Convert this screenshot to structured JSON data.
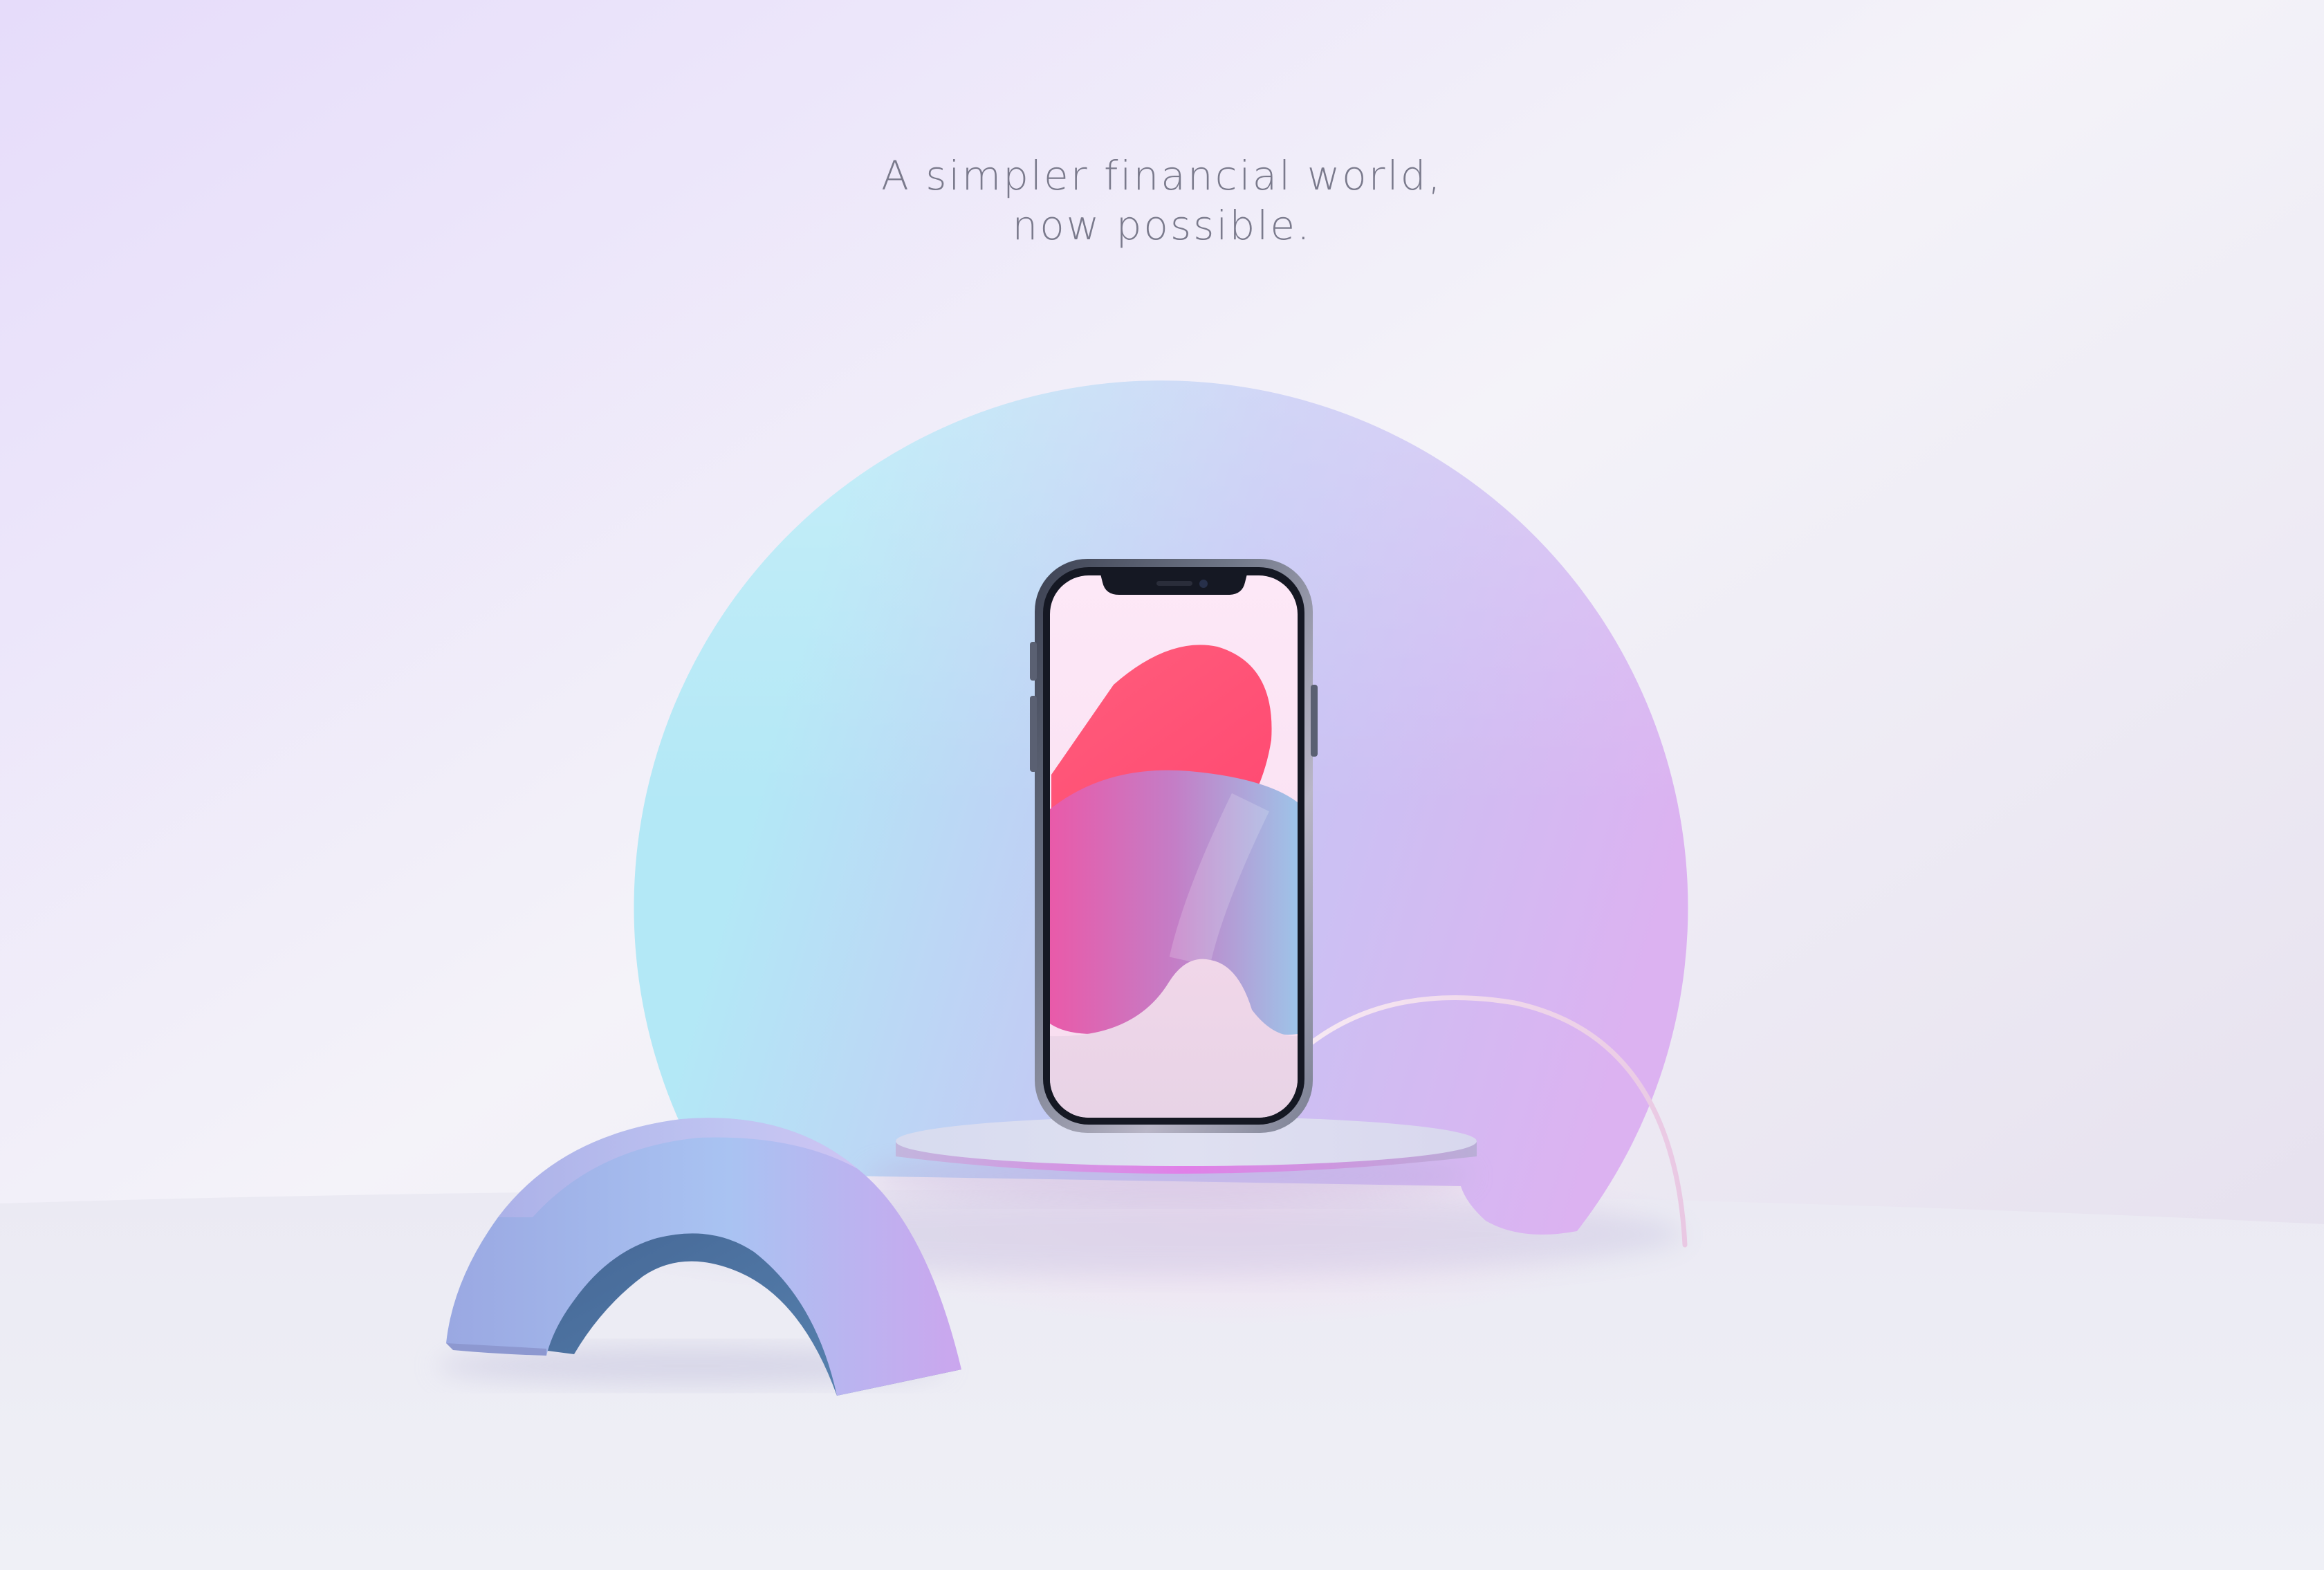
{
  "tagline": {
    "line1": "A simpler financial world,",
    "line2": "now possible."
  },
  "colors": {
    "background_top_left": "#e6dcfa",
    "background_light": "#f4f3f9",
    "background_right": "#e3ddec",
    "floor": "#eff0f6",
    "disc_cyan": "#b3e8f6",
    "disc_blue": "#c4c7f4",
    "disc_violet": "#dcb2f1",
    "arch_blue": "#9aa8e2",
    "arch_violet": "#cba6ee",
    "arch_inner": "#4a6d9c",
    "pedestal_top": "#d6d9ee",
    "pedestal_glow": "#d68fe6",
    "phone_frame": "#545a6a",
    "screen_background": "#fde8f7",
    "screen_pink": "#ff5277",
    "screen_magenta": "#e959a8",
    "screen_blue": "#9ec0e8",
    "screen_lilac": "#eddbe8",
    "wire": "#f0d4e8"
  }
}
